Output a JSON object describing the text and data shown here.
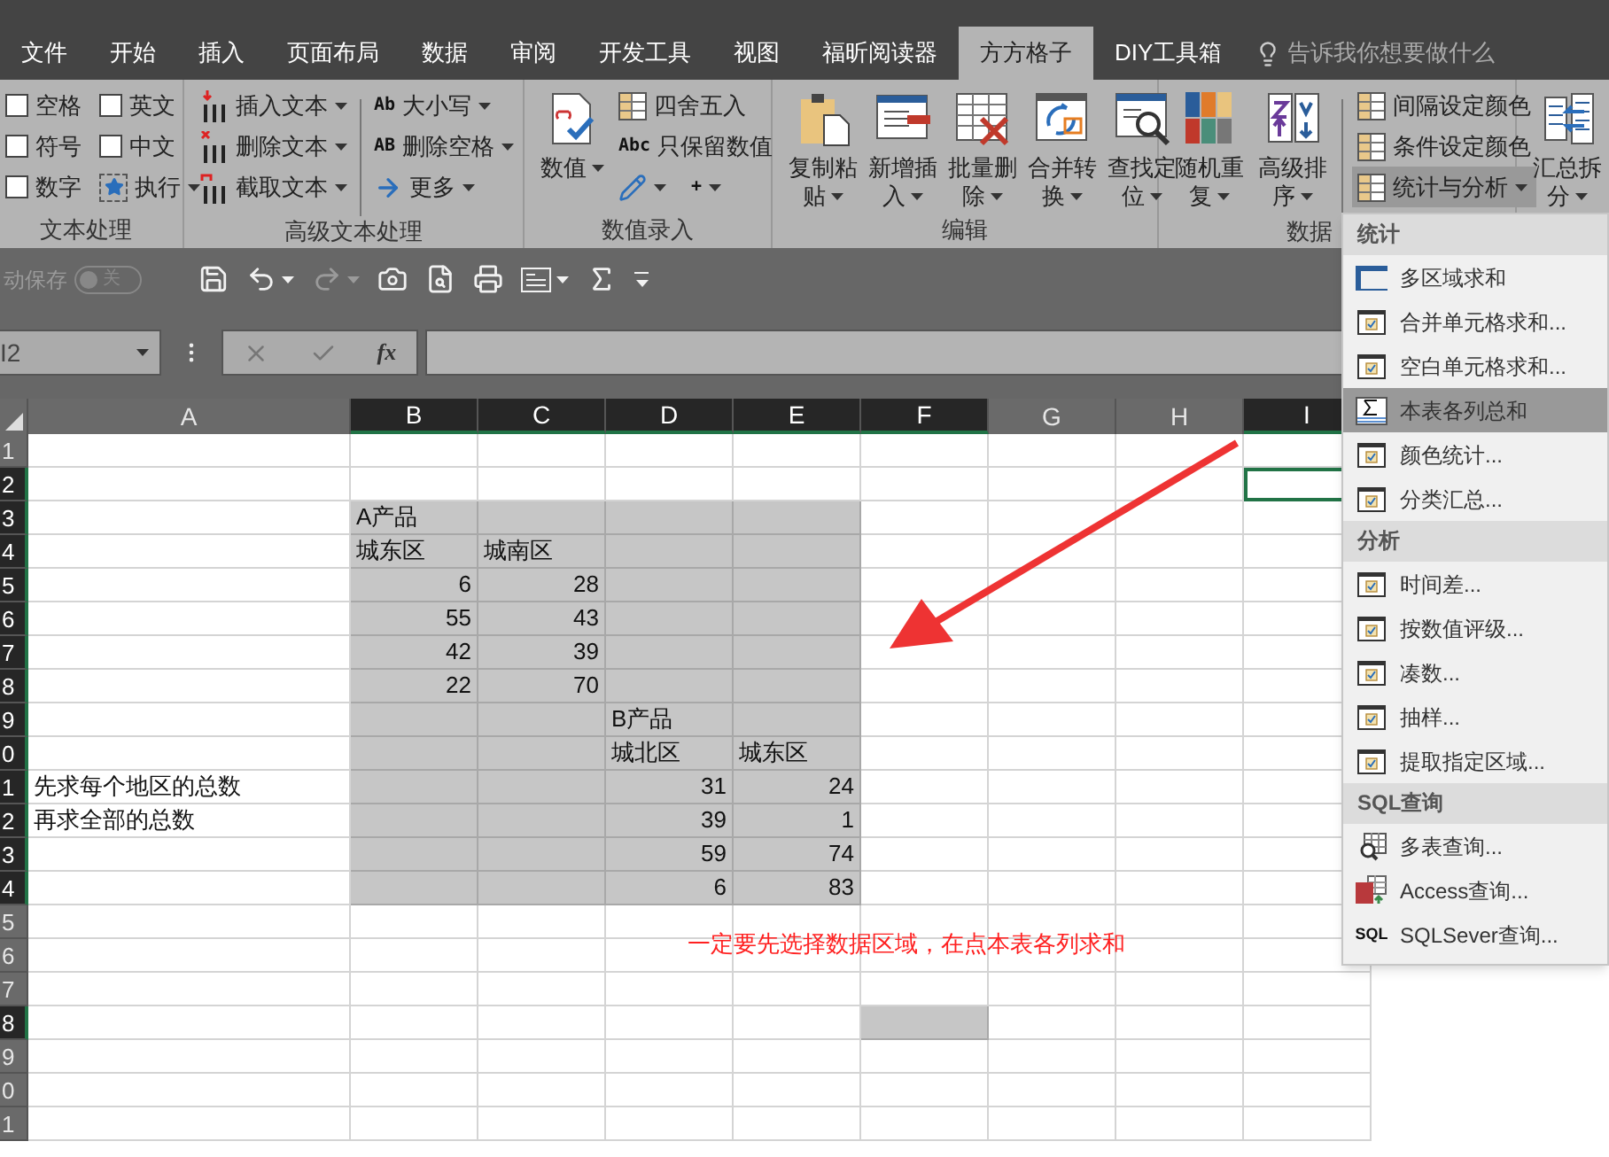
{
  "tabs": [
    {
      "label": "文件",
      "selected": false
    },
    {
      "label": "开始",
      "selected": false
    },
    {
      "label": "插入",
      "selected": false
    },
    {
      "label": "页面布局",
      "selected": false
    },
    {
      "label": "数据",
      "selected": false
    },
    {
      "label": "审阅",
      "selected": false
    },
    {
      "label": "开发工具",
      "selected": false
    },
    {
      "label": "视图",
      "selected": false
    },
    {
      "label": "福昕阅读器",
      "selected": false
    },
    {
      "label": "方方格子",
      "selected": true
    },
    {
      "label": "DIY工具箱",
      "selected": false
    }
  ],
  "tell_me": {
    "placeholder": "告诉我你想要做什么"
  },
  "ribbon_groups": [
    {
      "label": "文本处理",
      "items": [
        {
          "kind": "checkbox",
          "label": "空格",
          "checked": false
        },
        {
          "kind": "checkbox",
          "label": "符号",
          "checked": false
        },
        {
          "kind": "checkbox",
          "label": "数字",
          "checked": false
        },
        {
          "kind": "checkbox",
          "label": "英文",
          "checked": false
        },
        {
          "kind": "checkbox",
          "label": "中文",
          "checked": false
        },
        {
          "kind": "small",
          "label": "执行",
          "dropdown": true
        }
      ]
    },
    {
      "label": "高级文本处理",
      "items": [
        {
          "kind": "small",
          "label": "插入文本",
          "dropdown": true
        },
        {
          "kind": "small",
          "label": "删除文本",
          "dropdown": true
        },
        {
          "kind": "small",
          "label": "截取文本",
          "dropdown": true
        },
        {
          "kind": "small",
          "label": "大小写",
          "dropdown": true,
          "icon_text": "Ab"
        },
        {
          "kind": "small",
          "label": "删除空格",
          "dropdown": true,
          "icon_text": "AB"
        },
        {
          "kind": "small",
          "label": "更多",
          "dropdown": true
        }
      ]
    },
    {
      "label": "数值录入",
      "items": [
        {
          "kind": "large",
          "lines": [
            "数值"
          ],
          "dropdown": true
        },
        {
          "kind": "small",
          "label": "四舍五入",
          "dropdown": false
        },
        {
          "kind": "small",
          "label": "只保留数值",
          "dropdown": false,
          "icon_text": "Abc"
        },
        {
          "kind": "icon",
          "dropdown": true
        },
        {
          "kind": "icon",
          "dropdown": true,
          "icon_text": "+"
        }
      ]
    },
    {
      "label": "编辑",
      "items": [
        {
          "kind": "large",
          "lines": [
            "复制粘",
            "贴"
          ],
          "dropdown": true
        },
        {
          "kind": "large",
          "lines": [
            "新增插",
            "入"
          ],
          "dropdown": true
        },
        {
          "kind": "large",
          "lines": [
            "批量删",
            "除"
          ],
          "dropdown": true
        },
        {
          "kind": "large",
          "lines": [
            "合并转",
            "换"
          ],
          "dropdown": true
        },
        {
          "kind": "large",
          "lines": [
            "查找定",
            "位"
          ],
          "dropdown": true
        }
      ]
    },
    {
      "label": "数据",
      "items": [
        {
          "kind": "large",
          "lines": [
            "随机重",
            "复"
          ],
          "dropdown": true
        },
        {
          "kind": "large",
          "lines": [
            "高级排",
            "序"
          ],
          "dropdown": true
        },
        {
          "kind": "small",
          "label": "间隔设定颜色",
          "dropdown": false,
          "selected": false
        },
        {
          "kind": "small",
          "label": "条件设定颜色",
          "dropdown": false,
          "selected": false
        },
        {
          "kind": "small",
          "label": "统计与分析",
          "dropdown": true,
          "selected": true
        }
      ]
    },
    {
      "items": [
        {
          "kind": "large",
          "lines": [
            "汇总拆",
            "分"
          ],
          "dropdown": true
        }
      ]
    }
  ],
  "quick_access": {
    "autosave_label": "动保存",
    "autosave": {
      "on": false,
      "label": "关"
    },
    "buttons": [
      {
        "kind": "save",
        "dropdown": false,
        "disabled": false
      },
      {
        "kind": "undo",
        "dropdown": true,
        "disabled": false
      },
      {
        "kind": "redo",
        "dropdown": true,
        "disabled": true
      },
      {
        "kind": "camera",
        "dropdown": false,
        "disabled": false
      },
      {
        "kind": "preview",
        "dropdown": false,
        "disabled": false
      },
      {
        "kind": "print",
        "dropdown": false,
        "disabled": false
      },
      {
        "kind": "form",
        "dropdown": true,
        "disabled": false
      },
      {
        "kind": "sum",
        "dropdown": false,
        "disabled": false
      },
      {
        "kind": "customize",
        "dropdown": true,
        "disabled": false
      }
    ]
  },
  "formula_bar": {
    "name_box": "I2",
    "fx": "fx"
  },
  "columns": [
    {
      "label": "A",
      "selected": false
    },
    {
      "label": "B",
      "selected": true
    },
    {
      "label": "C",
      "selected": true
    },
    {
      "label": "D",
      "selected": true
    },
    {
      "label": "E",
      "selected": true
    },
    {
      "label": "F",
      "selected": true
    },
    {
      "label": "G",
      "selected": false
    },
    {
      "label": "H",
      "selected": false
    },
    {
      "label": "I",
      "selected": true
    }
  ],
  "rows": [
    {
      "label": "1",
      "selected": false,
      "cells": [
        {
          "highlighted": false,
          "active": false
        },
        {
          "highlighted": false,
          "active": false
        },
        {
          "highlighted": false,
          "active": false
        },
        {
          "highlighted": false,
          "active": false
        },
        {
          "highlighted": false,
          "active": false
        },
        {
          "highlighted": false,
          "active": false
        },
        {
          "highlighted": false,
          "active": false
        },
        {
          "highlighted": false,
          "active": false
        },
        {
          "highlighted": false,
          "active": false
        }
      ]
    },
    {
      "label": "2",
      "selected": true,
      "cells": [
        {
          "highlighted": false,
          "active": false
        },
        {
          "highlighted": false,
          "active": false
        },
        {
          "highlighted": false,
          "active": false
        },
        {
          "highlighted": false,
          "active": false
        },
        {
          "highlighted": false,
          "active": false
        },
        {
          "highlighted": false,
          "active": false
        },
        {
          "highlighted": false,
          "active": false
        },
        {
          "highlighted": false,
          "active": false
        },
        {
          "highlighted": false,
          "active": true
        }
      ]
    },
    {
      "label": "3",
      "selected": true,
      "cells": [
        {
          "highlighted": false,
          "active": false
        },
        {
          "highlighted": true,
          "active": false,
          "text": "A产品",
          "kind": "text"
        },
        {
          "highlighted": true,
          "active": false
        },
        {
          "highlighted": true,
          "active": false
        },
        {
          "highlighted": true,
          "active": false
        },
        {
          "highlighted": false,
          "active": false
        },
        {
          "highlighted": false,
          "active": false
        },
        {
          "highlighted": false,
          "active": false
        },
        {
          "highlighted": false,
          "active": false
        }
      ]
    },
    {
      "label": "4",
      "selected": true,
      "cells": [
        {
          "highlighted": false,
          "active": false
        },
        {
          "highlighted": true,
          "active": false,
          "text": "城东区",
          "kind": "text"
        },
        {
          "highlighted": true,
          "active": false,
          "text": "城南区",
          "kind": "text"
        },
        {
          "highlighted": true,
          "active": false
        },
        {
          "highlighted": true,
          "active": false
        },
        {
          "highlighted": false,
          "active": false
        },
        {
          "highlighted": false,
          "active": false
        },
        {
          "highlighted": false,
          "active": false
        },
        {
          "highlighted": false,
          "active": false
        }
      ]
    },
    {
      "label": "5",
      "selected": true,
      "cells": [
        {
          "highlighted": false,
          "active": false
        },
        {
          "highlighted": true,
          "active": false,
          "text": "6",
          "kind": "number"
        },
        {
          "highlighted": true,
          "active": false,
          "text": "28",
          "kind": "number"
        },
        {
          "highlighted": true,
          "active": false
        },
        {
          "highlighted": true,
          "active": false
        },
        {
          "highlighted": false,
          "active": false
        },
        {
          "highlighted": false,
          "active": false
        },
        {
          "highlighted": false,
          "active": false
        },
        {
          "highlighted": false,
          "active": false
        }
      ]
    },
    {
      "label": "6",
      "selected": true,
      "cells": [
        {
          "highlighted": false,
          "active": false
        },
        {
          "highlighted": true,
          "active": false,
          "text": "55",
          "kind": "number"
        },
        {
          "highlighted": true,
          "active": false,
          "text": "43",
          "kind": "number"
        },
        {
          "highlighted": true,
          "active": false
        },
        {
          "highlighted": true,
          "active": false
        },
        {
          "highlighted": false,
          "active": false
        },
        {
          "highlighted": false,
          "active": false
        },
        {
          "highlighted": false,
          "active": false
        },
        {
          "highlighted": false,
          "active": false
        }
      ]
    },
    {
      "label": "7",
      "selected": true,
      "cells": [
        {
          "highlighted": false,
          "active": false
        },
        {
          "highlighted": true,
          "active": false,
          "text": "42",
          "kind": "number"
        },
        {
          "highlighted": true,
          "active": false,
          "text": "39",
          "kind": "number"
        },
        {
          "highlighted": true,
          "active": false
        },
        {
          "highlighted": true,
          "active": false
        },
        {
          "highlighted": false,
          "active": false
        },
        {
          "highlighted": false,
          "active": false
        },
        {
          "highlighted": false,
          "active": false
        },
        {
          "highlighted": false,
          "active": false
        }
      ]
    },
    {
      "label": "8",
      "selected": true,
      "cells": [
        {
          "highlighted": false,
          "active": false
        },
        {
          "highlighted": true,
          "active": false,
          "text": "22",
          "kind": "number"
        },
        {
          "highlighted": true,
          "active": false,
          "text": "70",
          "kind": "number"
        },
        {
          "highlighted": true,
          "active": false
        },
        {
          "highlighted": true,
          "active": false
        },
        {
          "highlighted": false,
          "active": false
        },
        {
          "highlighted": false,
          "active": false
        },
        {
          "highlighted": false,
          "active": false
        },
        {
          "highlighted": false,
          "active": false
        }
      ]
    },
    {
      "label": "9",
      "selected": true,
      "cells": [
        {
          "highlighted": false,
          "active": false
        },
        {
          "highlighted": true,
          "active": false
        },
        {
          "highlighted": true,
          "active": false
        },
        {
          "highlighted": true,
          "active": false,
          "text": "B产品",
          "kind": "text"
        },
        {
          "highlighted": true,
          "active": false
        },
        {
          "highlighted": false,
          "active": false
        },
        {
          "highlighted": false,
          "active": false
        },
        {
          "highlighted": false,
          "active": false
        },
        {
          "highlighted": false,
          "active": false
        }
      ]
    },
    {
      "label": "0",
      "selected": true,
      "cells": [
        {
          "highlighted": false,
          "active": false
        },
        {
          "highlighted": true,
          "active": false
        },
        {
          "highlighted": true,
          "active": false
        },
        {
          "highlighted": true,
          "active": false,
          "text": "城北区",
          "kind": "text"
        },
        {
          "highlighted": true,
          "active": false,
          "text": "城东区",
          "kind": "text"
        },
        {
          "highlighted": false,
          "active": false
        },
        {
          "highlighted": false,
          "active": false
        },
        {
          "highlighted": false,
          "active": false
        },
        {
          "highlighted": false,
          "active": false
        }
      ]
    },
    {
      "label": "1",
      "selected": true,
      "cells": [
        {
          "highlighted": false,
          "active": false,
          "text": "先求每个地区的总数",
          "kind": "text"
        },
        {
          "highlighted": true,
          "active": false
        },
        {
          "highlighted": true,
          "active": false
        },
        {
          "highlighted": true,
          "active": false,
          "text": "31",
          "kind": "number"
        },
        {
          "highlighted": true,
          "active": false,
          "text": "24",
          "kind": "number"
        },
        {
          "highlighted": false,
          "active": false
        },
        {
          "highlighted": false,
          "active": false
        },
        {
          "highlighted": false,
          "active": false
        },
        {
          "highlighted": false,
          "active": false
        }
      ]
    },
    {
      "label": "2",
      "selected": true,
      "cells": [
        {
          "highlighted": false,
          "active": false,
          "text": "再求全部的总数",
          "kind": "text"
        },
        {
          "highlighted": true,
          "active": false
        },
        {
          "highlighted": true,
          "active": false
        },
        {
          "highlighted": true,
          "active": false,
          "text": "39",
          "kind": "number"
        },
        {
          "highlighted": true,
          "active": false,
          "text": "1",
          "kind": "number"
        },
        {
          "highlighted": false,
          "active": false
        },
        {
          "highlighted": false,
          "active": false
        },
        {
          "highlighted": false,
          "active": false
        },
        {
          "highlighted": false,
          "active": false
        }
      ]
    },
    {
      "label": "3",
      "selected": true,
      "cells": [
        {
          "highlighted": false,
          "active": false
        },
        {
          "highlighted": true,
          "active": false
        },
        {
          "highlighted": true,
          "active": false
        },
        {
          "highlighted": true,
          "active": false,
          "text": "59",
          "kind": "number"
        },
        {
          "highlighted": true,
          "active": false,
          "text": "74",
          "kind": "number"
        },
        {
          "highlighted": false,
          "active": false
        },
        {
          "highlighted": false,
          "active": false
        },
        {
          "highlighted": false,
          "active": false
        },
        {
          "highlighted": false,
          "active": false
        }
      ]
    },
    {
      "label": "4",
      "selected": true,
      "cells": [
        {
          "highlighted": false,
          "active": false
        },
        {
          "highlighted": true,
          "active": false
        },
        {
          "highlighted": true,
          "active": false
        },
        {
          "highlighted": true,
          "active": false,
          "text": "6",
          "kind": "number"
        },
        {
          "highlighted": true,
          "active": false,
          "text": "83",
          "kind": "number"
        },
        {
          "highlighted": false,
          "active": false
        },
        {
          "highlighted": false,
          "active": false
        },
        {
          "highlighted": false,
          "active": false
        },
        {
          "highlighted": false,
          "active": false
        }
      ]
    },
    {
      "label": "5",
      "selected": false,
      "cells": [
        {
          "highlighted": false,
          "active": false
        },
        {
          "highlighted": false,
          "active": false
        },
        {
          "highlighted": false,
          "active": false
        },
        {
          "highlighted": false,
          "active": false
        },
        {
          "highlighted": false,
          "active": false
        },
        {
          "highlighted": false,
          "active": false
        },
        {
          "highlighted": false,
          "active": false
        },
        {
          "highlighted": false,
          "active": false
        },
        {
          "highlighted": false,
          "active": false
        }
      ]
    },
    {
      "label": "6",
      "selected": false,
      "cells": [
        {
          "highlighted": false,
          "active": false
        },
        {
          "highlighted": false,
          "active": false
        },
        {
          "highlighted": false,
          "active": false
        },
        {
          "highlighted": false,
          "active": false
        },
        {
          "highlighted": false,
          "active": false
        },
        {
          "highlighted": false,
          "active": false
        },
        {
          "highlighted": false,
          "active": false
        },
        {
          "highlighted": false,
          "active": false
        },
        {
          "highlighted": false,
          "active": false
        }
      ]
    },
    {
      "label": "7",
      "selected": false,
      "cells": [
        {
          "highlighted": false,
          "active": false
        },
        {
          "highlighted": false,
          "active": false
        },
        {
          "highlighted": false,
          "active": false
        },
        {
          "highlighted": false,
          "active": false
        },
        {
          "highlighted": false,
          "active": false
        },
        {
          "highlighted": false,
          "active": false
        },
        {
          "highlighted": false,
          "active": false
        },
        {
          "highlighted": false,
          "active": false
        },
        {
          "highlighted": false,
          "active": false
        }
      ]
    },
    {
      "label": "8",
      "selected": true,
      "cells": [
        {
          "highlighted": false,
          "active": false
        },
        {
          "highlighted": false,
          "active": false
        },
        {
          "highlighted": false,
          "active": false
        },
        {
          "highlighted": false,
          "active": false
        },
        {
          "highlighted": false,
          "active": false
        },
        {
          "highlighted": true,
          "active": false
        },
        {
          "highlighted": false,
          "active": false
        },
        {
          "highlighted": false,
          "active": false
        },
        {
          "highlighted": false,
          "active": false
        }
      ]
    },
    {
      "label": "9",
      "selected": false,
      "cells": [
        {
          "highlighted": false,
          "active": false
        },
        {
          "highlighted": false,
          "active": false
        },
        {
          "highlighted": false,
          "active": false
        },
        {
          "highlighted": false,
          "active": false
        },
        {
          "highlighted": false,
          "active": false
        },
        {
          "highlighted": false,
          "active": false
        },
        {
          "highlighted": false,
          "active": false
        },
        {
          "highlighted": false,
          "active": false
        },
        {
          "highlighted": false,
          "active": false
        }
      ]
    },
    {
      "label": "0",
      "selected": false,
      "cells": [
        {
          "highlighted": false,
          "active": false
        },
        {
          "highlighted": false,
          "active": false
        },
        {
          "highlighted": false,
          "active": false
        },
        {
          "highlighted": false,
          "active": false
        },
        {
          "highlighted": false,
          "active": false
        },
        {
          "highlighted": false,
          "active": false
        },
        {
          "highlighted": false,
          "active": false
        },
        {
          "highlighted": false,
          "active": false
        },
        {
          "highlighted": false,
          "active": false
        }
      ]
    },
    {
      "label": "1",
      "selected": false,
      "cells": [
        {
          "highlighted": false,
          "active": false
        },
        {
          "highlighted": false,
          "active": false
        },
        {
          "highlighted": false,
          "active": false
        },
        {
          "highlighted": false,
          "active": false
        },
        {
          "highlighted": false,
          "active": false
        },
        {
          "highlighted": false,
          "active": false
        },
        {
          "highlighted": false,
          "active": false
        },
        {
          "highlighted": false,
          "active": false
        },
        {
          "highlighted": false,
          "active": false
        }
      ]
    }
  ],
  "annotation": {
    "text": "一定要先选择数据区域，在点本表各列求和"
  },
  "menu": {
    "sections": [
      {
        "title": "统计",
        "items": [
          {
            "kind": "table",
            "label": "多区域求和",
            "selected": false
          },
          {
            "kind": "dialog",
            "label": "合并单元格求和...",
            "selected": false
          },
          {
            "kind": "dialog",
            "label": "空白单元格求和...",
            "selected": false
          },
          {
            "kind": "sigma",
            "label": "本表各列总和",
            "selected": true
          },
          {
            "kind": "dialog",
            "label": "颜色统计...",
            "selected": false
          },
          {
            "kind": "dialog",
            "label": "分类汇总...",
            "selected": false
          }
        ]
      },
      {
        "title": "分析",
        "items": [
          {
            "kind": "dialog",
            "label": "时间差...",
            "selected": false
          },
          {
            "kind": "dialog",
            "label": "按数值评级...",
            "selected": false
          },
          {
            "kind": "dialog",
            "label": "凑数...",
            "selected": false
          },
          {
            "kind": "dialog",
            "label": "抽样...",
            "selected": false
          },
          {
            "kind": "dialog",
            "label": "提取指定区域...",
            "selected": false
          }
        ]
      },
      {
        "title": "SQL查询",
        "items": [
          {
            "kind": "query",
            "label": "多表查询...",
            "selected": false
          },
          {
            "kind": "access",
            "label": "Access查询...",
            "selected": false
          },
          {
            "kind": "sql",
            "label": "SQLSever查询...",
            "selected": false,
            "icon_text": "SQL"
          }
        ]
      }
    ]
  }
}
